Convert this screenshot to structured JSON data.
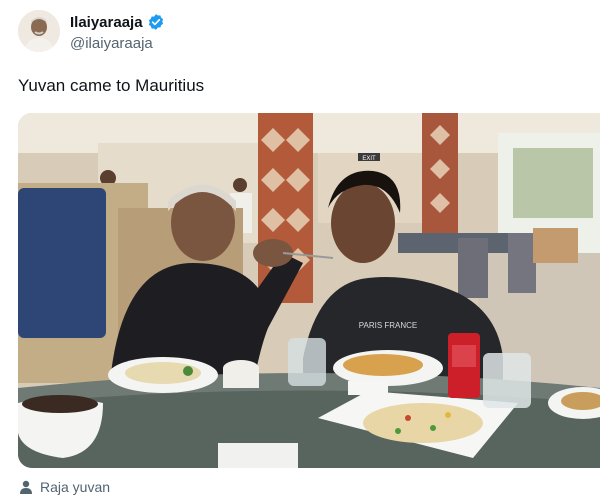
{
  "tweet": {
    "author": {
      "display_name": "Ilaiyaraaja",
      "handle": "@ilaiyaraaja",
      "verified": true
    },
    "text": "Yuvan came to Mauritius",
    "media": {
      "shirt_text": "PARIS FRANCE",
      "sign_text": "EXIT"
    },
    "tagged_user": "Raja yuvan"
  },
  "colors": {
    "verified_blue": "#1d9bf0",
    "secondary_text": "#536471",
    "primary_text": "#0f1419"
  }
}
